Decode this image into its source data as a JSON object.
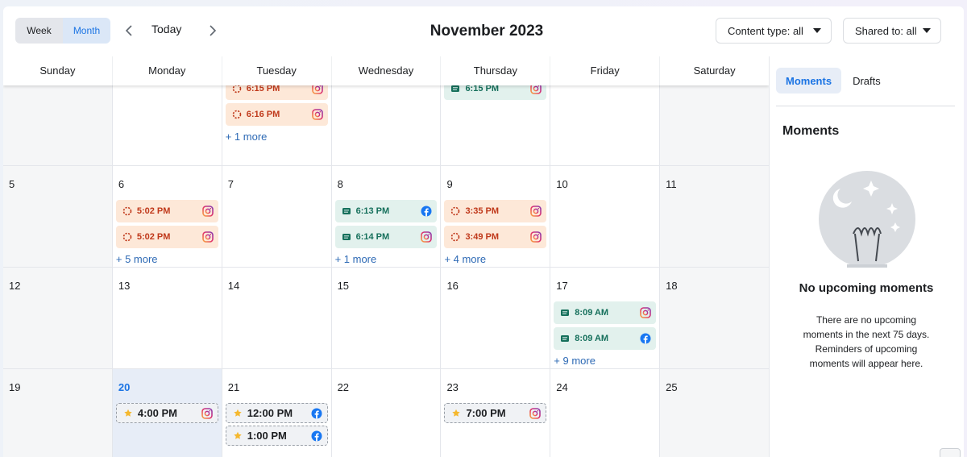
{
  "view_toggle": {
    "week_label": "Week",
    "month_label": "Month",
    "active": "Month"
  },
  "nav": {
    "today_label": "Today",
    "month_title": "November 2023"
  },
  "filters": {
    "content_type_label": "Content type: all",
    "shared_to_label": "Shared to: all"
  },
  "weekdays": [
    "Sunday",
    "Monday",
    "Tuesday",
    "Wednesday",
    "Thursday",
    "Friday",
    "Saturday"
  ],
  "colors": {
    "accent": "#1b74e4",
    "draft_bg": "#fde8d8",
    "draft_text": "#c0391b",
    "published_bg": "#e2f1ed",
    "published_text": "#16705c",
    "today_bg": "#e7edf7"
  },
  "weeks": [
    {
      "days": [
        {
          "num": "",
          "weekend": true,
          "events": []
        },
        {
          "num": "",
          "events": []
        },
        {
          "num": "",
          "events": [
            {
              "kind": "draft",
              "time": "6:15 PM",
              "platform": "instagram"
            },
            {
              "kind": "draft",
              "time": "6:16 PM",
              "platform": "instagram"
            }
          ],
          "more": "+ 1 more"
        },
        {
          "num": "",
          "events": []
        },
        {
          "num": "",
          "events": [
            {
              "kind": "pub",
              "time": "6:15 PM",
              "platform": "instagram"
            }
          ]
        },
        {
          "num": "",
          "events": []
        },
        {
          "num": "",
          "weekend": true,
          "events": []
        }
      ]
    },
    {
      "days": [
        {
          "num": "5",
          "weekend": true,
          "events": []
        },
        {
          "num": "6",
          "events": [
            {
              "kind": "draft",
              "time": "5:02 PM",
              "platform": "instagram"
            },
            {
              "kind": "draft",
              "time": "5:02 PM",
              "platform": "instagram"
            }
          ],
          "more": "+ 5 more"
        },
        {
          "num": "7",
          "events": []
        },
        {
          "num": "8",
          "events": [
            {
              "kind": "pub",
              "time": "6:13 PM",
              "platform": "facebook"
            },
            {
              "kind": "pub",
              "time": "6:14 PM",
              "platform": "instagram"
            }
          ],
          "more": "+ 1 more"
        },
        {
          "num": "9",
          "events": [
            {
              "kind": "draft",
              "time": "3:35 PM",
              "platform": "instagram"
            },
            {
              "kind": "draft",
              "time": "3:49 PM",
              "platform": "instagram"
            }
          ],
          "more": "+ 4 more"
        },
        {
          "num": "10",
          "events": []
        },
        {
          "num": "11",
          "weekend": true,
          "events": []
        }
      ]
    },
    {
      "days": [
        {
          "num": "12",
          "weekend": true,
          "events": []
        },
        {
          "num": "13",
          "events": []
        },
        {
          "num": "14",
          "events": []
        },
        {
          "num": "15",
          "events": []
        },
        {
          "num": "16",
          "events": []
        },
        {
          "num": "17",
          "events": [
            {
              "kind": "pub",
              "time": "8:09 AM",
              "platform": "instagram"
            },
            {
              "kind": "pub",
              "time": "8:09 AM",
              "platform": "facebook"
            }
          ],
          "more": "+ 9 more"
        },
        {
          "num": "18",
          "weekend": true,
          "events": []
        }
      ]
    },
    {
      "days": [
        {
          "num": "19",
          "weekend": true,
          "events": []
        },
        {
          "num": "20",
          "today": true,
          "events": [
            {
              "kind": "moment",
              "time": "4:00 PM",
              "platform": "instagram"
            }
          ]
        },
        {
          "num": "21",
          "events": [
            {
              "kind": "moment",
              "time": "12:00 PM",
              "platform": "facebook"
            },
            {
              "kind": "moment",
              "time": "1:00 PM",
              "platform": "facebook"
            }
          ]
        },
        {
          "num": "22",
          "events": []
        },
        {
          "num": "23",
          "events": [
            {
              "kind": "moment",
              "time": "7:00 PM",
              "platform": "instagram"
            }
          ]
        },
        {
          "num": "24",
          "events": []
        },
        {
          "num": "25",
          "weekend": true,
          "events": []
        }
      ]
    }
  ],
  "sidebar": {
    "tabs": [
      {
        "label": "Moments",
        "active": true
      },
      {
        "label": "Drafts",
        "active": false
      }
    ],
    "heading": "Moments",
    "empty_title": "No upcoming moments",
    "empty_text": "There are no upcoming moments in the next 75 days. Reminders of upcoming moments will appear here."
  }
}
